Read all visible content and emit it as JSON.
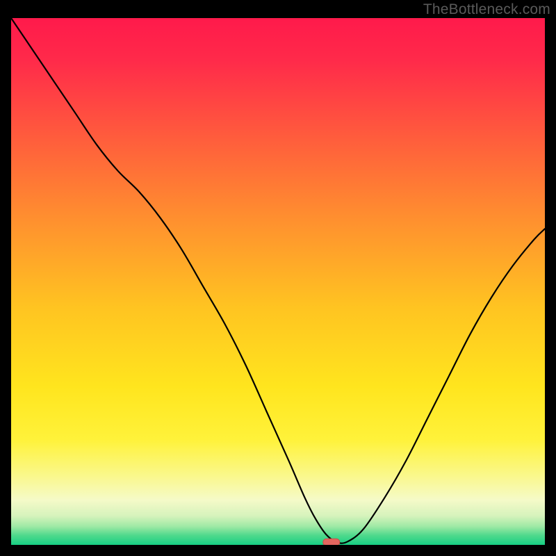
{
  "watermark": "TheBottleneck.com",
  "colors": {
    "frame": "#000000",
    "watermark": "#5a5a5a",
    "curve": "#000000",
    "marker_fill": "#e4665f",
    "marker_stroke": "#d14b46",
    "gradient_stops": [
      {
        "offset": 0.0,
        "color": "#ff1a4b"
      },
      {
        "offset": 0.08,
        "color": "#ff2a4a"
      },
      {
        "offset": 0.22,
        "color": "#ff5a3d"
      },
      {
        "offset": 0.38,
        "color": "#ff8f2f"
      },
      {
        "offset": 0.55,
        "color": "#ffc421"
      },
      {
        "offset": 0.7,
        "color": "#ffe51e"
      },
      {
        "offset": 0.8,
        "color": "#fff23a"
      },
      {
        "offset": 0.87,
        "color": "#faf88d"
      },
      {
        "offset": 0.915,
        "color": "#f5fac8"
      },
      {
        "offset": 0.945,
        "color": "#d6f3bc"
      },
      {
        "offset": 0.965,
        "color": "#9ee9a5"
      },
      {
        "offset": 0.982,
        "color": "#4fd98c"
      },
      {
        "offset": 1.0,
        "color": "#17cf84"
      }
    ]
  },
  "chart_data": {
    "type": "line",
    "title": "",
    "xlabel": "",
    "ylabel": "",
    "xlim": [
      0,
      100
    ],
    "ylim": [
      0,
      100
    ],
    "series": [
      {
        "name": "bottleneck-curve",
        "x": [
          0,
          4,
          8,
          12,
          16,
          20,
          24,
          28,
          32,
          36,
          40,
          44,
          48,
          52,
          55,
          57,
          59,
          61,
          63,
          66,
          70,
          74,
          78,
          82,
          86,
          90,
          94,
          98,
          100
        ],
        "values": [
          100,
          94,
          88,
          82,
          76,
          71,
          67,
          62,
          56,
          49,
          42,
          34,
          25,
          16,
          9,
          5,
          2,
          0.5,
          0.6,
          3,
          9,
          16,
          24,
          32,
          40,
          47,
          53,
          58,
          60
        ]
      }
    ],
    "marker": {
      "x": 60,
      "y": 0.5
    },
    "annotations": []
  }
}
